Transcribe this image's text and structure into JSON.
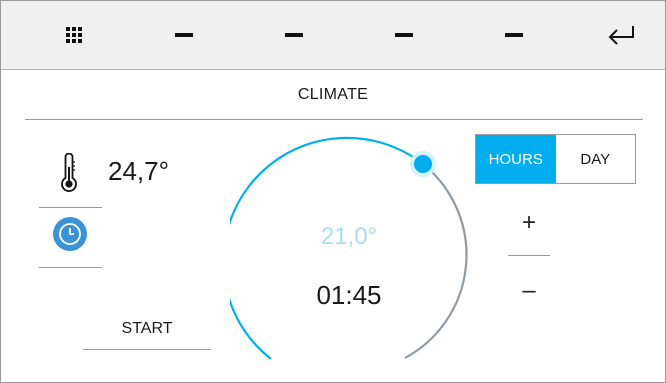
{
  "topbar": {
    "items": [
      {
        "icon": "grid-icon"
      },
      {
        "icon": "dash-icon"
      },
      {
        "icon": "dash-icon"
      },
      {
        "icon": "dash-icon"
      },
      {
        "icon": "dash-icon"
      },
      {
        "icon": "return-arrow-icon"
      }
    ]
  },
  "header": {
    "title": "CLIMATE"
  },
  "climate": {
    "current_temperature": "24,7°",
    "setpoint": "21,0°",
    "timer": "01:45",
    "start_label": "START",
    "dial_position": 0.0
  },
  "mode": {
    "options": [
      "HOURS",
      "DAY"
    ],
    "selected": "HOURS"
  },
  "controls": {
    "plus": "+",
    "minus": "–"
  },
  "colors": {
    "accent": "#00aeef",
    "setpoint_text": "#a9dcf3",
    "clock_button": "#3a93d4",
    "dial_track": "#8f9ca5",
    "topbar_bg": "#f0f0f0"
  }
}
